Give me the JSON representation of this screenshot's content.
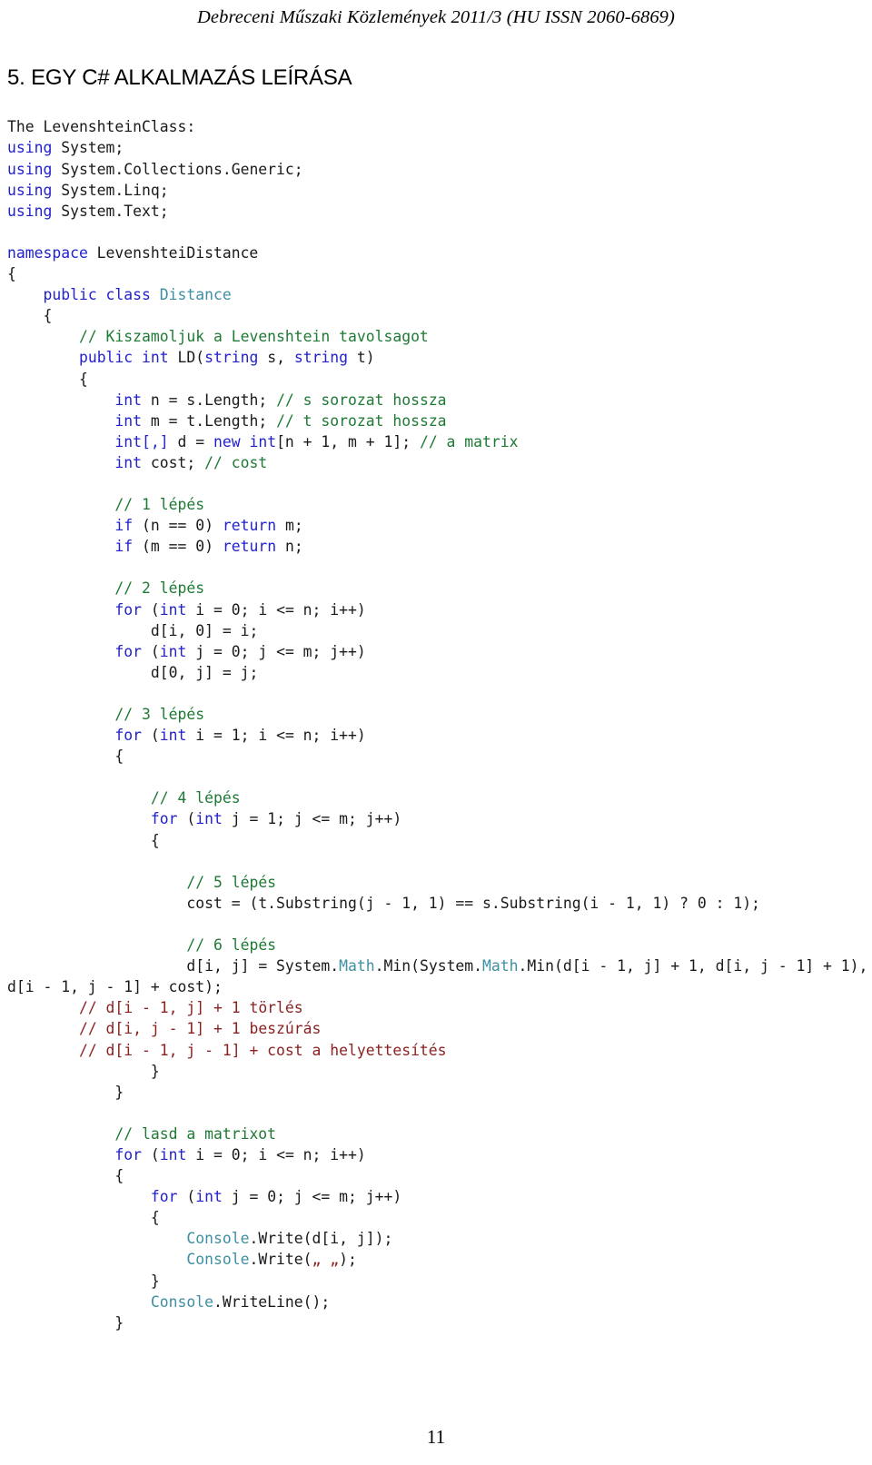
{
  "header": {
    "running_head": "Debreceni Műszaki Közlemények 2011/3 (HU ISSN 2060-6869)"
  },
  "section": {
    "title": "5. EGY C# ALKALMAZÁS LEÍRÁSA"
  },
  "footer": {
    "page_number": "11"
  },
  "colors": {
    "keyword": "#2222cc",
    "type": "#3f8fa3",
    "comment_green": "#1e7a35",
    "comment_red": "#8b2222",
    "string": "#8b2222",
    "text": "#1a1a1a"
  },
  "code": {
    "intro_label": "The LevenshteinClass:",
    "lines": [
      {
        "id": 0,
        "segments": [
          {
            "t": "The LevenshteinClass:",
            "c": "plain"
          }
        ]
      },
      {
        "id": 1,
        "segments": [
          {
            "t": "using",
            "c": "kw"
          },
          {
            "t": " System;",
            "c": "plain"
          }
        ]
      },
      {
        "id": 2,
        "segments": [
          {
            "t": "using",
            "c": "kw"
          },
          {
            "t": " System.Collections.Generic;",
            "c": "plain"
          }
        ]
      },
      {
        "id": 3,
        "segments": [
          {
            "t": "using",
            "c": "kw"
          },
          {
            "t": " System.Linq;",
            "c": "plain"
          }
        ]
      },
      {
        "id": 4,
        "segments": [
          {
            "t": "using",
            "c": "kw"
          },
          {
            "t": " System.Text;",
            "c": "plain"
          }
        ]
      },
      {
        "id": 5,
        "segments": []
      },
      {
        "id": 6,
        "segments": [
          {
            "t": "namespace",
            "c": "kw"
          },
          {
            "t": " LevenshteiDistance",
            "c": "plain"
          }
        ]
      },
      {
        "id": 7,
        "segments": [
          {
            "t": "{",
            "c": "plain"
          }
        ]
      },
      {
        "id": 8,
        "segments": [
          {
            "t": "    ",
            "c": "plain"
          },
          {
            "t": "public class",
            "c": "kw"
          },
          {
            "t": " ",
            "c": "plain"
          },
          {
            "t": "Distance",
            "c": "typ"
          }
        ]
      },
      {
        "id": 9,
        "segments": [
          {
            "t": "    {",
            "c": "plain"
          }
        ]
      },
      {
        "id": 10,
        "segments": [
          {
            "t": "        ",
            "c": "plain"
          },
          {
            "t": "// Kiszamoljuk a Levenshtein tavolsagot",
            "c": "cmt"
          }
        ]
      },
      {
        "id": 11,
        "segments": [
          {
            "t": "        ",
            "c": "plain"
          },
          {
            "t": "public int",
            "c": "kw"
          },
          {
            "t": " LD(",
            "c": "plain"
          },
          {
            "t": "string",
            "c": "kw"
          },
          {
            "t": " s, ",
            "c": "plain"
          },
          {
            "t": "string",
            "c": "kw"
          },
          {
            "t": " t)",
            "c": "plain"
          }
        ]
      },
      {
        "id": 12,
        "segments": [
          {
            "t": "        {",
            "c": "plain"
          }
        ]
      },
      {
        "id": 13,
        "segments": [
          {
            "t": "            ",
            "c": "plain"
          },
          {
            "t": "int",
            "c": "kw"
          },
          {
            "t": " n = s.Length; ",
            "c": "plain"
          },
          {
            "t": "// s sorozat hossza",
            "c": "cmt"
          }
        ]
      },
      {
        "id": 14,
        "segments": [
          {
            "t": "            ",
            "c": "plain"
          },
          {
            "t": "int",
            "c": "kw"
          },
          {
            "t": " m = t.Length; ",
            "c": "plain"
          },
          {
            "t": "// t sorozat hossza",
            "c": "cmt"
          }
        ]
      },
      {
        "id": 15,
        "segments": [
          {
            "t": "            ",
            "c": "plain"
          },
          {
            "t": "int[,]",
            "c": "kw"
          },
          {
            "t": " d = ",
            "c": "plain"
          },
          {
            "t": "new int",
            "c": "kw"
          },
          {
            "t": "[n + 1, m + 1]; ",
            "c": "plain"
          },
          {
            "t": "// a matrix",
            "c": "cmt"
          }
        ]
      },
      {
        "id": 16,
        "segments": [
          {
            "t": "            ",
            "c": "plain"
          },
          {
            "t": "int",
            "c": "kw"
          },
          {
            "t": " cost; ",
            "c": "plain"
          },
          {
            "t": "// cost",
            "c": "cmt"
          }
        ]
      },
      {
        "id": 17,
        "segments": []
      },
      {
        "id": 18,
        "segments": [
          {
            "t": "            ",
            "c": "plain"
          },
          {
            "t": "// 1 lépés",
            "c": "cmt"
          }
        ]
      },
      {
        "id": 19,
        "segments": [
          {
            "t": "            ",
            "c": "plain"
          },
          {
            "t": "if",
            "c": "kw"
          },
          {
            "t": " (n == 0) ",
            "c": "plain"
          },
          {
            "t": "return",
            "c": "kw"
          },
          {
            "t": " m;",
            "c": "plain"
          }
        ]
      },
      {
        "id": 20,
        "segments": [
          {
            "t": "            ",
            "c": "plain"
          },
          {
            "t": "if",
            "c": "kw"
          },
          {
            "t": " (m == 0) ",
            "c": "plain"
          },
          {
            "t": "return",
            "c": "kw"
          },
          {
            "t": " n;",
            "c": "plain"
          }
        ]
      },
      {
        "id": 21,
        "segments": []
      },
      {
        "id": 22,
        "segments": [
          {
            "t": "            ",
            "c": "plain"
          },
          {
            "t": "// 2 lépés",
            "c": "cmt"
          }
        ]
      },
      {
        "id": 23,
        "segments": [
          {
            "t": "            ",
            "c": "plain"
          },
          {
            "t": "for",
            "c": "kw"
          },
          {
            "t": " (",
            "c": "plain"
          },
          {
            "t": "int",
            "c": "kw"
          },
          {
            "t": " i = 0; i <= n; i++)",
            "c": "plain"
          }
        ]
      },
      {
        "id": 24,
        "segments": [
          {
            "t": "                d[i, 0] = i;",
            "c": "plain"
          }
        ]
      },
      {
        "id": 25,
        "segments": [
          {
            "t": "            ",
            "c": "plain"
          },
          {
            "t": "for",
            "c": "kw"
          },
          {
            "t": " (",
            "c": "plain"
          },
          {
            "t": "int",
            "c": "kw"
          },
          {
            "t": " j = 0; j <= m; j++)",
            "c": "plain"
          }
        ]
      },
      {
        "id": 26,
        "segments": [
          {
            "t": "                d[0, j] = j;",
            "c": "plain"
          }
        ]
      },
      {
        "id": 27,
        "segments": []
      },
      {
        "id": 28,
        "segments": [
          {
            "t": "            ",
            "c": "plain"
          },
          {
            "t": "// 3 lépés",
            "c": "cmt"
          }
        ]
      },
      {
        "id": 29,
        "segments": [
          {
            "t": "            ",
            "c": "plain"
          },
          {
            "t": "for",
            "c": "kw"
          },
          {
            "t": " (",
            "c": "plain"
          },
          {
            "t": "int",
            "c": "kw"
          },
          {
            "t": " i = 1; i <= n; i++)",
            "c": "plain"
          }
        ]
      },
      {
        "id": 30,
        "segments": [
          {
            "t": "            {",
            "c": "plain"
          }
        ]
      },
      {
        "id": 31,
        "segments": []
      },
      {
        "id": 32,
        "segments": [
          {
            "t": "                ",
            "c": "plain"
          },
          {
            "t": "// 4 lépés",
            "c": "cmt"
          }
        ]
      },
      {
        "id": 33,
        "segments": [
          {
            "t": "                ",
            "c": "plain"
          },
          {
            "t": "for",
            "c": "kw"
          },
          {
            "t": " (",
            "c": "plain"
          },
          {
            "t": "int",
            "c": "kw"
          },
          {
            "t": " j = 1; j <= m; j++)",
            "c": "plain"
          }
        ]
      },
      {
        "id": 34,
        "segments": [
          {
            "t": "                {",
            "c": "plain"
          }
        ]
      },
      {
        "id": 35,
        "segments": []
      },
      {
        "id": 36,
        "segments": [
          {
            "t": "                    ",
            "c": "plain"
          },
          {
            "t": "// 5 lépés",
            "c": "cmt"
          }
        ]
      },
      {
        "id": 37,
        "segments": [
          {
            "t": "                    cost = (t.Substring(j - 1, 1) == s.Substring(i - 1, 1) ? 0 : 1);",
            "c": "plain"
          }
        ]
      },
      {
        "id": 38,
        "segments": []
      },
      {
        "id": 39,
        "segments": [
          {
            "t": "                    ",
            "c": "plain"
          },
          {
            "t": "// 6 lépés",
            "c": "cmt"
          }
        ]
      },
      {
        "id": 40,
        "segments": [
          {
            "t": "                    d[i, j] = System.",
            "c": "plain"
          },
          {
            "t": "Math",
            "c": "typ"
          },
          {
            "t": ".Min(System.",
            "c": "plain"
          },
          {
            "t": "Math",
            "c": "typ"
          },
          {
            "t": ".Min(d[i - 1, j] + 1, d[i, j - 1] + 1), d[i - 1, j - 1] + cost);",
            "c": "plain"
          }
        ]
      },
      {
        "id": 41,
        "segments": [
          {
            "t": "        ",
            "c": "plain"
          },
          {
            "t": "// d[i - 1, j] + 1 törlés",
            "c": "cmt2"
          }
        ]
      },
      {
        "id": 42,
        "segments": [
          {
            "t": "        ",
            "c": "plain"
          },
          {
            "t": "// d[i, j - 1] + 1 beszúrás",
            "c": "cmt2"
          }
        ]
      },
      {
        "id": 43,
        "segments": [
          {
            "t": "        ",
            "c": "plain"
          },
          {
            "t": "// d[i - 1, j - 1] + cost a helyettesítés",
            "c": "cmt2"
          }
        ]
      },
      {
        "id": 44,
        "segments": [
          {
            "t": "                }",
            "c": "plain"
          }
        ]
      },
      {
        "id": 45,
        "segments": [
          {
            "t": "            }",
            "c": "plain"
          }
        ]
      },
      {
        "id": 46,
        "segments": []
      },
      {
        "id": 47,
        "segments": [
          {
            "t": "            ",
            "c": "plain"
          },
          {
            "t": "// lasd a matrixot",
            "c": "cmt"
          }
        ]
      },
      {
        "id": 48,
        "segments": [
          {
            "t": "            ",
            "c": "plain"
          },
          {
            "t": "for",
            "c": "kw"
          },
          {
            "t": " (",
            "c": "plain"
          },
          {
            "t": "int",
            "c": "kw"
          },
          {
            "t": " i = 0; i <= n; i++)",
            "c": "plain"
          }
        ]
      },
      {
        "id": 49,
        "segments": [
          {
            "t": "            {",
            "c": "plain"
          }
        ]
      },
      {
        "id": 50,
        "segments": [
          {
            "t": "                ",
            "c": "plain"
          },
          {
            "t": "for",
            "c": "kw"
          },
          {
            "t": " (",
            "c": "plain"
          },
          {
            "t": "int",
            "c": "kw"
          },
          {
            "t": " j = 0; j <= m; j++)",
            "c": "plain"
          }
        ]
      },
      {
        "id": 51,
        "segments": [
          {
            "t": "                {",
            "c": "plain"
          }
        ]
      },
      {
        "id": 52,
        "segments": [
          {
            "t": "                    ",
            "c": "plain"
          },
          {
            "t": "Console",
            "c": "typ"
          },
          {
            "t": ".Write(d[i, j]);",
            "c": "plain"
          }
        ]
      },
      {
        "id": 53,
        "segments": [
          {
            "t": "                    ",
            "c": "plain"
          },
          {
            "t": "Console",
            "c": "typ"
          },
          {
            "t": ".Write(",
            "c": "plain"
          },
          {
            "t": "„ „",
            "c": "str"
          },
          {
            "t": ");",
            "c": "plain"
          }
        ]
      },
      {
        "id": 54,
        "segments": [
          {
            "t": "                }",
            "c": "plain"
          }
        ]
      },
      {
        "id": 55,
        "segments": [
          {
            "t": "                ",
            "c": "plain"
          },
          {
            "t": "Console",
            "c": "typ"
          },
          {
            "t": ".WriteLine();",
            "c": "plain"
          }
        ]
      },
      {
        "id": 56,
        "segments": [
          {
            "t": "            }",
            "c": "plain"
          }
        ]
      }
    ]
  }
}
